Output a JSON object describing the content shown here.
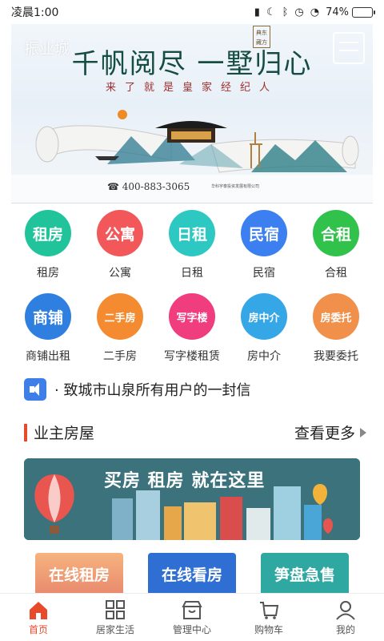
{
  "status_bar": {
    "time": "凌晨1:00",
    "battery": "74%",
    "battery_level": 0.74
  },
  "banner": {
    "brand": "振业城",
    "slogan": "千帆阅尽 一墅归心",
    "seal": "典东藏方",
    "subtitle": "来了就是皇家经纪人",
    "phone": "☎ 400-883-3065",
    "company": "华科宇泰投资发展有限公司"
  },
  "categories": [
    {
      "label": "租房",
      "icon_text": "租房",
      "color": "#21c39a",
      "name": "zufang"
    },
    {
      "label": "公寓",
      "icon_text": "公寓",
      "color": "#f2585a",
      "name": "gongyu"
    },
    {
      "label": "日租",
      "icon_text": "日租",
      "color": "#2ec8c2",
      "name": "rizu"
    },
    {
      "label": "民宿",
      "icon_text": "民宿",
      "color": "#3b7ff0",
      "name": "minsu"
    },
    {
      "label": "合租",
      "icon_text": "合租",
      "color": "#30c24a",
      "name": "hezu"
    },
    {
      "label": "商铺出租",
      "icon_text": "商铺",
      "color": "#2f7fe0",
      "name": "shangpu"
    },
    {
      "label": "二手房",
      "icon_text": "二手房",
      "color": "#f58b30",
      "name": "ershoufang"
    },
    {
      "label": "写字楼租赁",
      "icon_text": "写字楼",
      "color": "#ef3d7e",
      "name": "xiezilou"
    },
    {
      "label": "房中介",
      "icon_text": "房中介",
      "color": "#35a7e6",
      "name": "fangzhongjie"
    },
    {
      "label": "我要委托",
      "icon_text": "房委托",
      "color": "#f0904a",
      "name": "weituo"
    }
  ],
  "notice": {
    "text": "· 致城市山泉所有用户的一封信"
  },
  "section": {
    "title": "业主房屋",
    "more": "查看更多"
  },
  "promo": {
    "text": "买房 租房 就在这里"
  },
  "cards": [
    {
      "label": "在线租房"
    },
    {
      "label": "在线看房"
    },
    {
      "label": "笋盘急售"
    }
  ],
  "tabs": [
    {
      "label": "首页",
      "icon": "home-icon",
      "active": true
    },
    {
      "label": "居家生活",
      "icon": "grid-icon",
      "active": false
    },
    {
      "label": "管理中心",
      "icon": "shop-icon",
      "active": false
    },
    {
      "label": "购物车",
      "icon": "cart-icon",
      "active": false
    },
    {
      "label": "我的",
      "icon": "user-icon",
      "active": false
    }
  ],
  "colors": {
    "accent": "#e84a2a",
    "notice_icon": "#3d7ee8"
  }
}
